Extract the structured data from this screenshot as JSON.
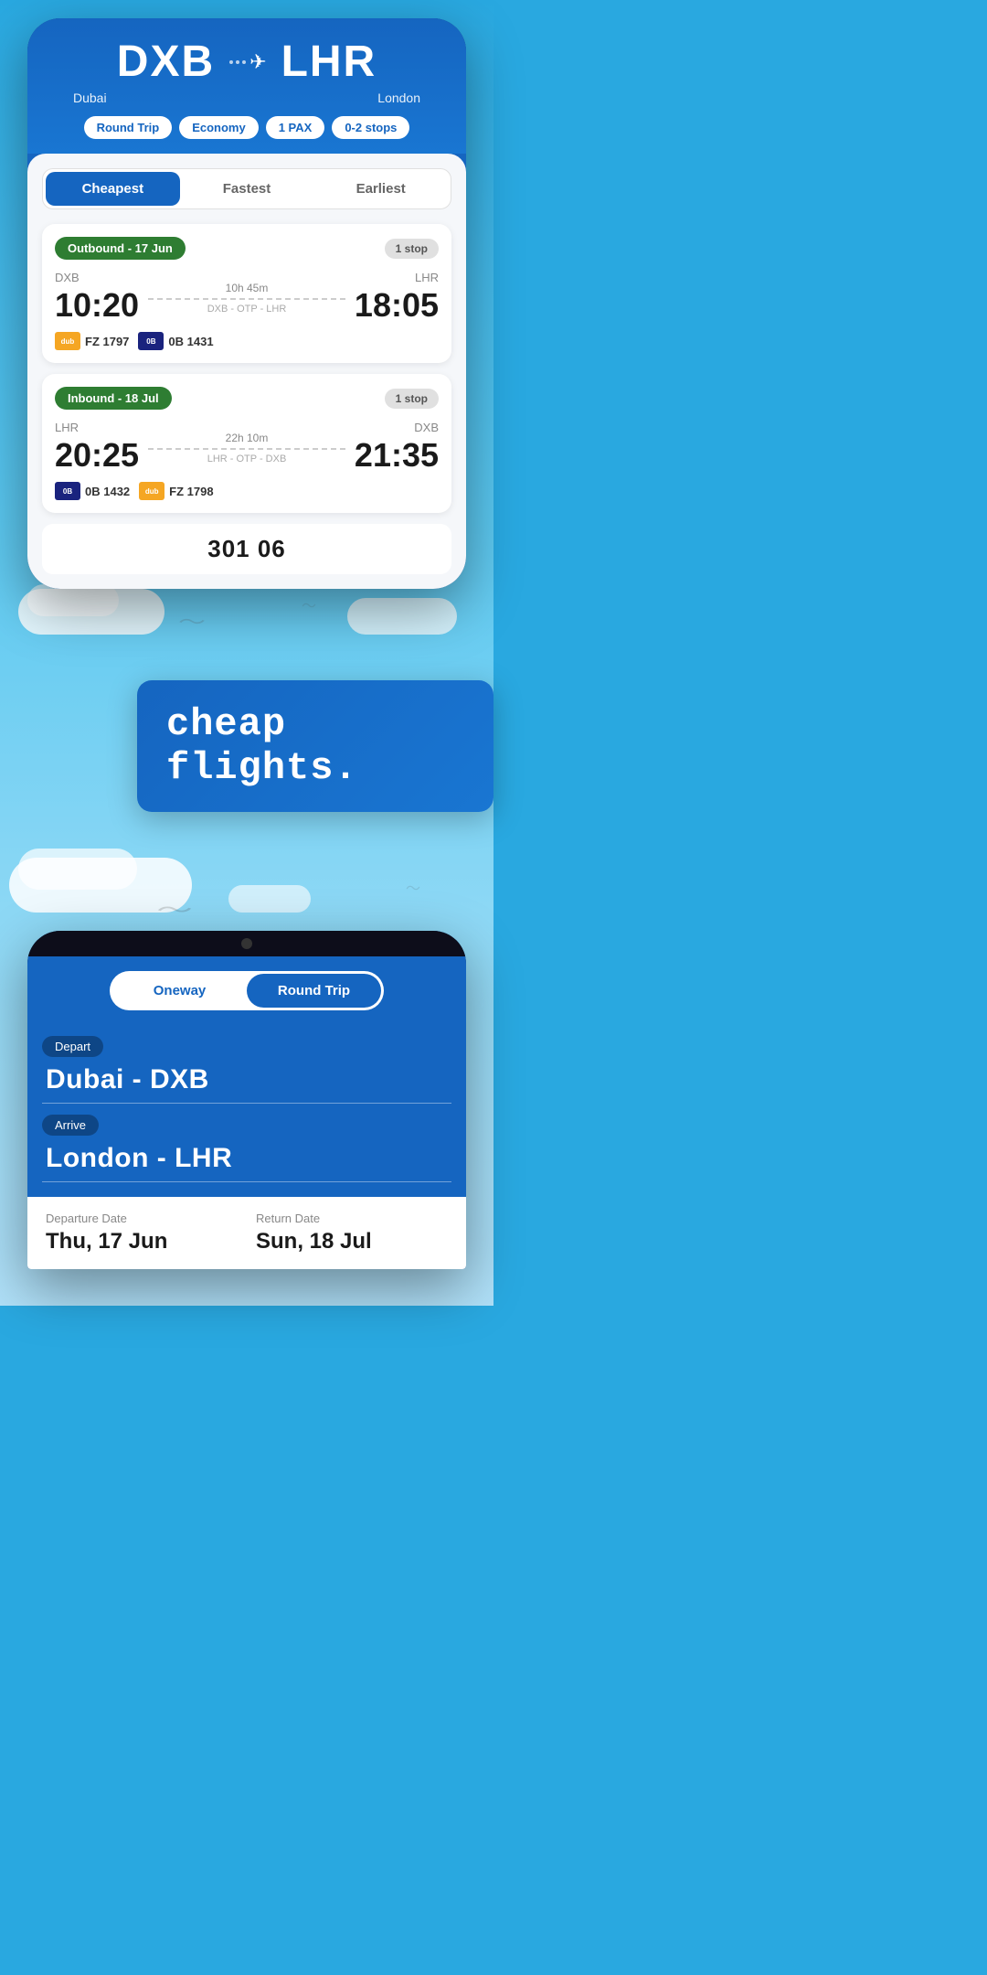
{
  "header": {
    "from_code": "DXB",
    "to_code": "LHR",
    "from_city": "Dubai",
    "to_city": "London",
    "trip_type": "Round Trip",
    "cabin": "Economy",
    "pax": "1 PAX",
    "stops": "0-2 stops"
  },
  "tabs": {
    "cheapest": "Cheapest",
    "fastest": "Fastest",
    "earliest": "Earliest"
  },
  "outbound": {
    "label": "Outbound - 17 Jun",
    "stop_badge": "1 stop",
    "from_code": "DXB",
    "to_code": "LHR",
    "depart_time": "10:20",
    "arrive_time": "18:05",
    "duration": "10h 45m",
    "route": "DXB - OTP - LHR",
    "airline1_logo": "dubai",
    "airline1_code": "FZ 1797",
    "airline2_logo": "blue",
    "airline2_code": "0B 1431"
  },
  "inbound": {
    "label": "Inbound - 18 Jul",
    "stop_badge": "1 stop",
    "from_code": "LHR",
    "to_code": "DXB",
    "depart_time": "20:25",
    "arrive_time": "21:35",
    "duration": "22h 10m",
    "route": "LHR - OTP - DXB",
    "airline1_logo": "blue",
    "airline1_code": "0B 1432",
    "airline2_logo": "dubai",
    "airline2_code": "FZ 1798"
  },
  "promo": {
    "text": "cheap flights."
  },
  "search_form": {
    "oneway_label": "Oneway",
    "round_trip_label": "Round Trip",
    "depart_label": "Depart",
    "depart_value": "Dubai - DXB",
    "arrive_label": "Arrive",
    "arrive_value": "London - LHR",
    "departure_date_label": "Departure Date",
    "departure_date_value": "Thu, 17 Jun",
    "return_date_label": "Return Date",
    "return_date_value": "Sun, 18 Jul"
  }
}
